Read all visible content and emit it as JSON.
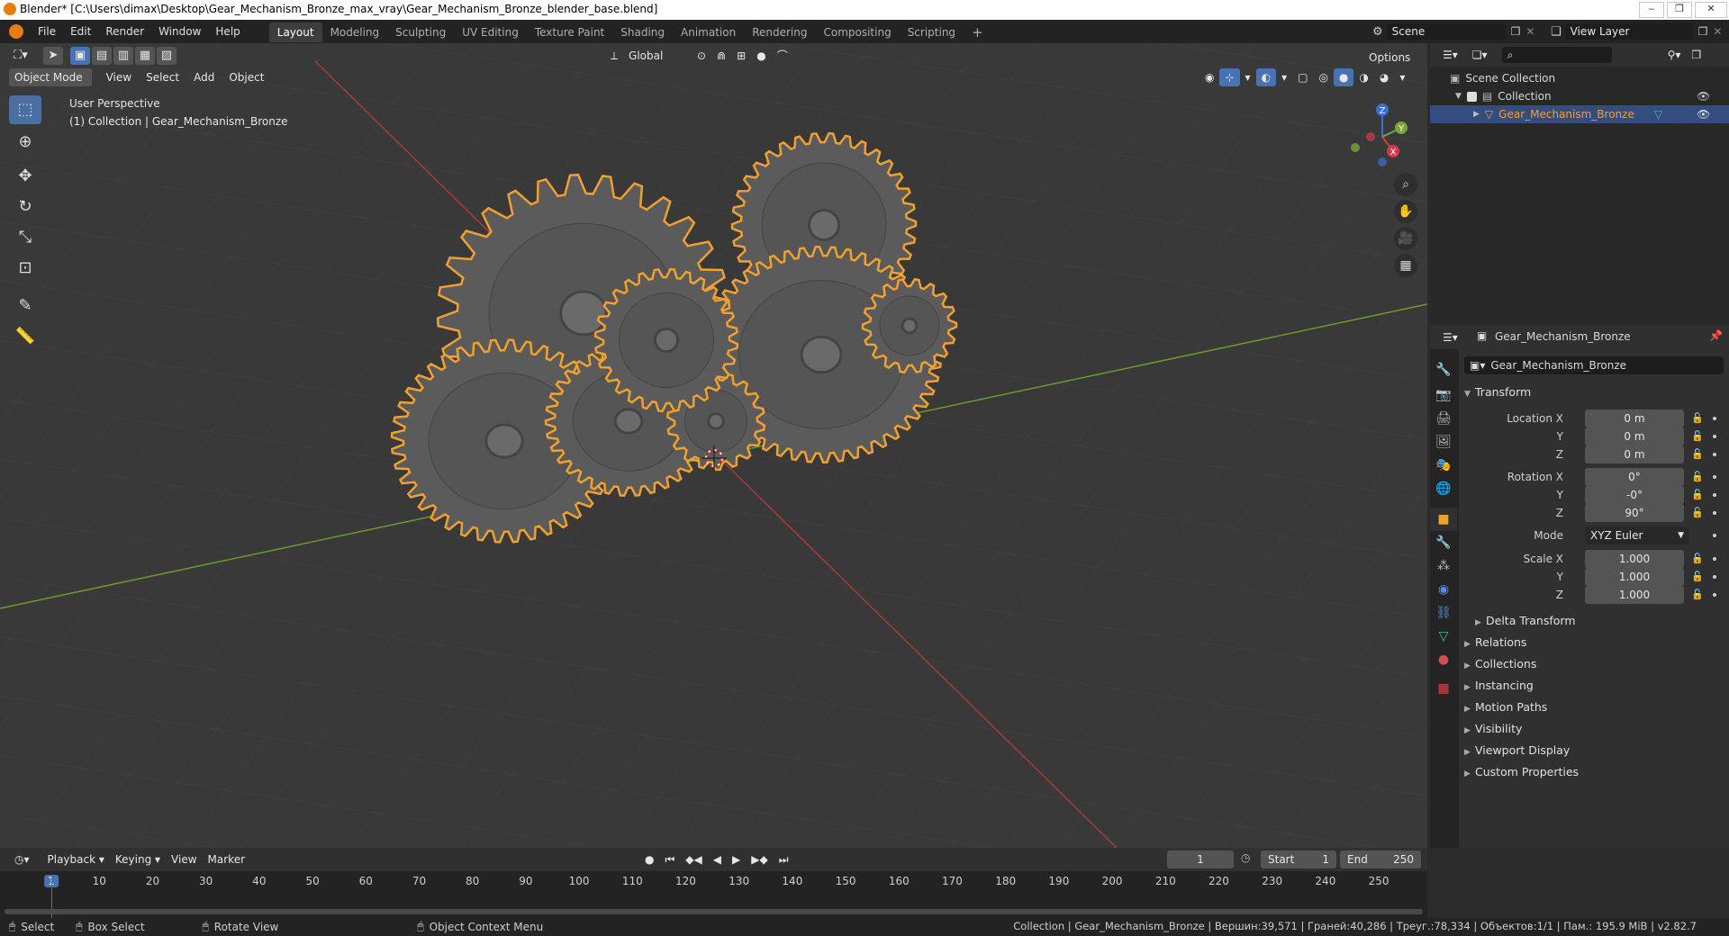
{
  "window": {
    "title": "Blender* [C:\\Users\\dimax\\Desktop\\Gear_Mechanism_Bronze_max_vray\\Gear_Mechanism_Bronze_blender_base.blend]",
    "controls": [
      "‒",
      "❐",
      "✕"
    ]
  },
  "menu": [
    "File",
    "Edit",
    "Render",
    "Window",
    "Help"
  ],
  "workspace_tabs": [
    {
      "label": "Layout",
      "active": true
    },
    {
      "label": "Modeling"
    },
    {
      "label": "Sculpting"
    },
    {
      "label": "UV Editing"
    },
    {
      "label": "Texture Paint"
    },
    {
      "label": "Shading"
    },
    {
      "label": "Animation"
    },
    {
      "label": "Rendering"
    },
    {
      "label": "Compositing"
    },
    {
      "label": "Scripting"
    }
  ],
  "scene": {
    "label": "Scene"
  },
  "view_layer": {
    "label": "View Layer"
  },
  "viewport": {
    "mode": "Object Mode",
    "menus": [
      "View",
      "Select",
      "Add",
      "Object"
    ],
    "orientation": "Global",
    "options_label": "Options",
    "overlay_text": {
      "line1": "User Perspective",
      "line2": "(1) Collection | Gear_Mechanism_Bronze"
    },
    "gizmo_axes": [
      "Z",
      "Y",
      "X"
    ],
    "tools": [
      "select-box",
      "cursor",
      "move",
      "rotate",
      "scale",
      "transform",
      "annotate",
      "measure"
    ]
  },
  "outliner": {
    "root": "Scene Collection",
    "collection": "Collection",
    "object": "Gear_Mechanism_Bronze"
  },
  "properties": {
    "object_name": "Gear_Mechanism_Bronze",
    "datablock_name": "Gear_Mechanism_Bronze",
    "transform_header": "Transform",
    "location": {
      "label_x": "Location X",
      "label_y": "Y",
      "label_z": "Z",
      "x": "0 m",
      "y": "0 m",
      "z": "0 m"
    },
    "rotation": {
      "label_x": "Rotation X",
      "label_y": "Y",
      "label_z": "Z",
      "x": "0°",
      "y": "-0°",
      "z": "90°"
    },
    "mode": {
      "label": "Mode",
      "value": "XYZ Euler"
    },
    "scale": {
      "label_x": "Scale X",
      "label_y": "Y",
      "label_z": "Z",
      "x": "1.000",
      "y": "1.000",
      "z": "1.000"
    },
    "delta_transform": "Delta Transform",
    "sections": [
      "Relations",
      "Collections",
      "Instancing",
      "Motion Paths",
      "Visibility",
      "Viewport Display",
      "Custom Properties"
    ]
  },
  "timeline": {
    "menus": [
      "Playback",
      "Keying",
      "View",
      "Marker"
    ],
    "current_frame": "1",
    "start_label": "Start",
    "start": "1",
    "end_label": "End",
    "end": "250",
    "ticks": [
      "1",
      "10",
      "20",
      "30",
      "40",
      "50",
      "60",
      "70",
      "80",
      "90",
      "100",
      "110",
      "120",
      "130",
      "140",
      "150",
      "160",
      "170",
      "180",
      "190",
      "200",
      "210",
      "220",
      "230",
      "240",
      "250"
    ]
  },
  "statusbar": {
    "select": "Select",
    "box_select": "Box Select",
    "rotate_view": "Rotate View",
    "context_menu": "Object Context Menu",
    "stats": "Collection | Gear_Mechanism_Bronze | Вершин:39,571 | Граней:40,286 | Треуг.:78,334 | Объектов:1/1 | Пам.: 195.9 MiB | v2.82.7"
  },
  "colors": {
    "accent": "#4772b3",
    "selection_outline": "#f0a030",
    "axis_x": "#c0393b",
    "axis_y": "#6b9b2a"
  }
}
